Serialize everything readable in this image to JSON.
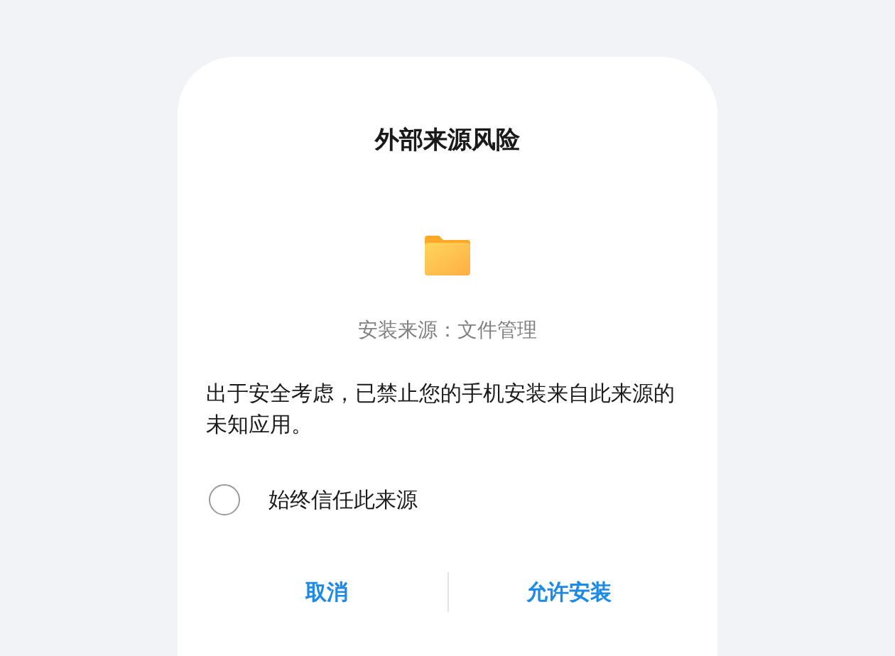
{
  "dialog": {
    "title": "外部来源风险",
    "source": "安装来源：文件管理",
    "message": "出于安全考虑，已禁止您的手机安装来自此来源的未知应用。",
    "option": {
      "label": "始终信任此来源",
      "checked": false
    },
    "buttons": [
      "取消",
      "允许安装"
    ]
  }
}
